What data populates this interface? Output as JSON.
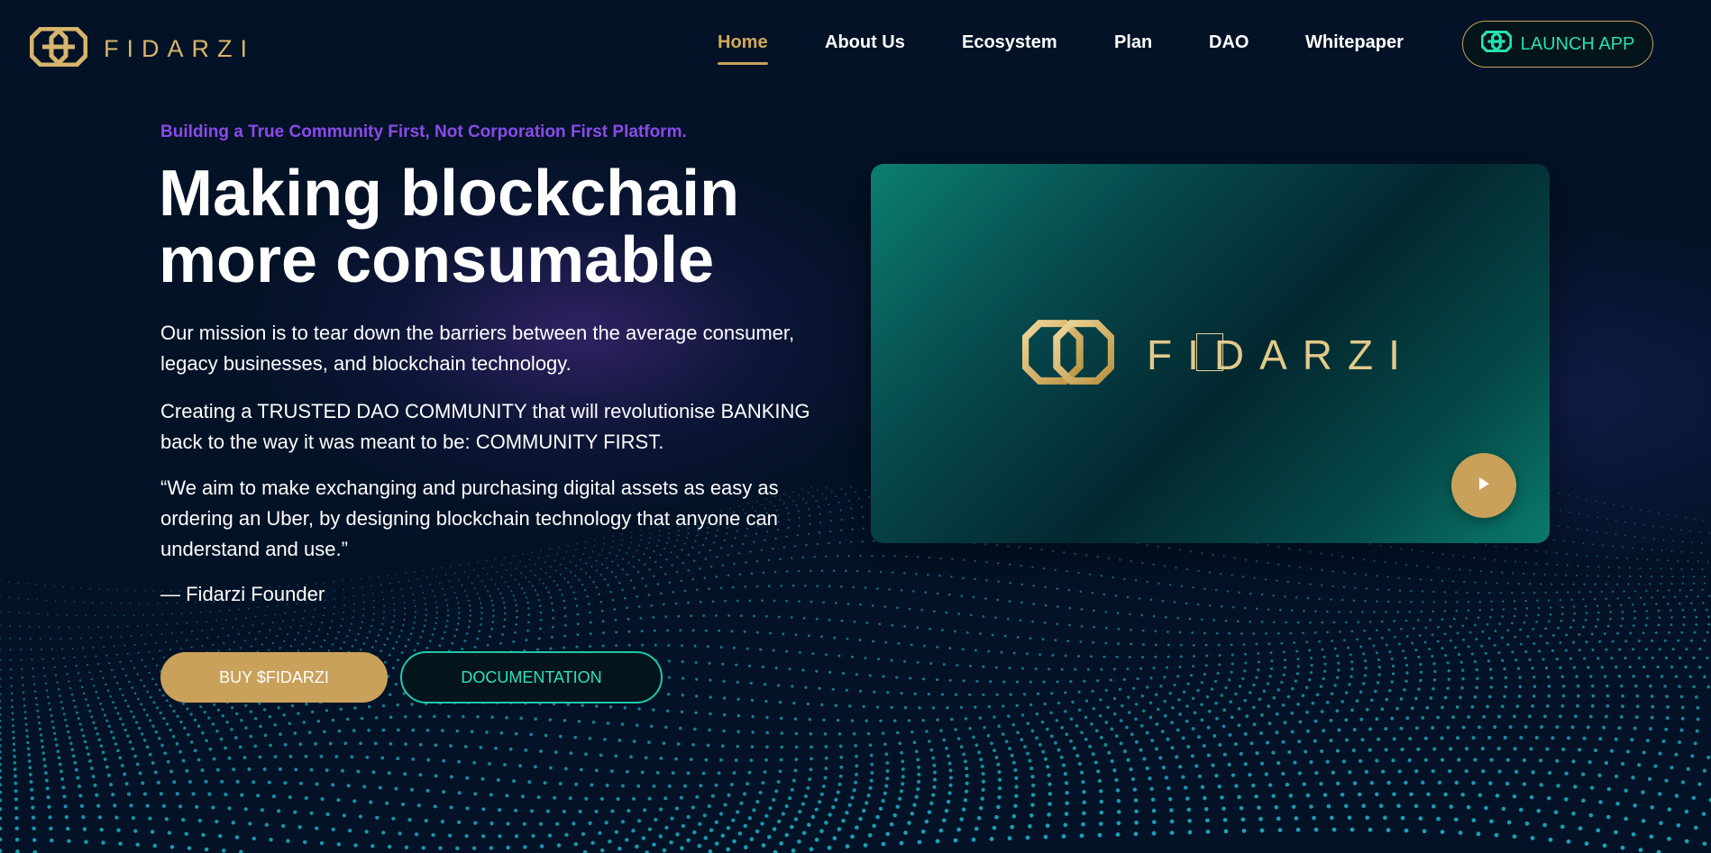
{
  "brand": {
    "name": "FIDARZI",
    "logo_icon": "fidarzi-octagon-logo-icon",
    "colors": {
      "gold": "#c9a15a",
      "teal": "#1fc9a9",
      "purple": "#8a4bea",
      "background": "#031226"
    }
  },
  "nav": {
    "items": [
      {
        "label": "Home",
        "active": true
      },
      {
        "label": "About Us"
      },
      {
        "label": "Ecosystem"
      },
      {
        "label": "Plan"
      },
      {
        "label": "DAO"
      },
      {
        "label": "Whitepaper"
      }
    ],
    "launch_label": "LAUNCH APP",
    "launch_icon": "fidarzi-octagon-logo-icon"
  },
  "hero": {
    "tagline": "Building a True Community First, Not Corporation First Platform.",
    "headline_line1": "Making blockchain",
    "headline_line2": "more consumable",
    "paragraphs": [
      "Our mission is to tear down the barriers between the average consumer, legacy businesses, and blockchain technology.",
      "Creating a TRUSTED DAO COMMUNITY that will revolutionise BANKING back to the way it was meant to be: COMMUNITY FIRST.",
      "“We aim to make exchanging and purchasing digital assets as easy as ordering an Uber, by designing blockchain technology that anyone can understand and use.”"
    ],
    "attribution": "— Fidarzi Founder",
    "buy_label": "BUY $FIDARZI",
    "docs_label": "DOCUMENTATION"
  },
  "video": {
    "brand_text": "FIDARZI",
    "play_icon": "play-icon"
  }
}
